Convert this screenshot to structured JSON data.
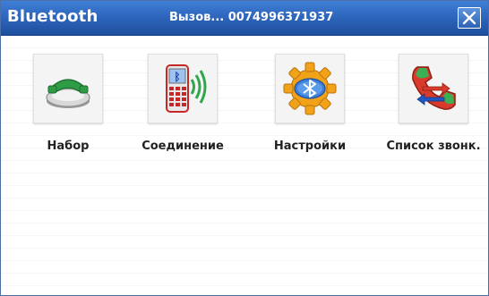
{
  "window": {
    "title": "Bluetooth",
    "call_status": "Вызов... 0074996371937",
    "close_icon": "close-icon"
  },
  "actions": [
    {
      "label": "Набор",
      "icon": "dial-phone-icon"
    },
    {
      "label": "Соединение",
      "icon": "bluetooth-phone-icon"
    },
    {
      "label": "Настройки",
      "icon": "bluetooth-settings-gear-icon"
    },
    {
      "label": "Список звонк.",
      "icon": "call-log-icon"
    }
  ],
  "colors": {
    "titlebar": "#2b62b8",
    "background": "#ffffff",
    "stripe": "#ececec",
    "label": "#222222"
  }
}
